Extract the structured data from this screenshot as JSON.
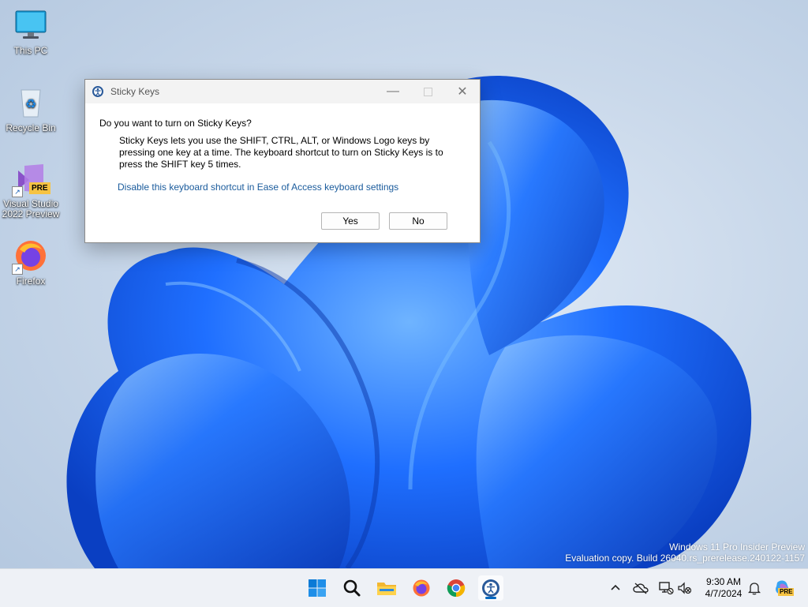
{
  "desktop": {
    "icons": [
      {
        "label": "This PC"
      },
      {
        "label": "Recycle Bin"
      },
      {
        "label": "Visual Studio 2022 Preview",
        "badge": "PRE"
      },
      {
        "label": "Firefox"
      }
    ]
  },
  "dialog": {
    "title": "Sticky Keys",
    "question": "Do you want to turn on Sticky Keys?",
    "description": "Sticky Keys lets you use the SHIFT, CTRL, ALT, or Windows Logo keys by pressing one key at a time. The keyboard shortcut to turn on Sticky Keys is to press the SHIFT key 5 times.",
    "link": "Disable this keyboard shortcut in Ease of Access keyboard settings",
    "yes_label": "Yes",
    "no_label": "No"
  },
  "watermark": {
    "line1": "Windows 11 Pro Insider Preview",
    "line2": "Evaluation copy. Build 26040.rs_prerelease.240122-1157"
  },
  "taskbar": {
    "time": "9:30 AM",
    "date": "4/7/2024",
    "copilot_badge": "PRE"
  },
  "colors": {
    "accent": "#0067c0",
    "link": "#1a5b9c"
  }
}
